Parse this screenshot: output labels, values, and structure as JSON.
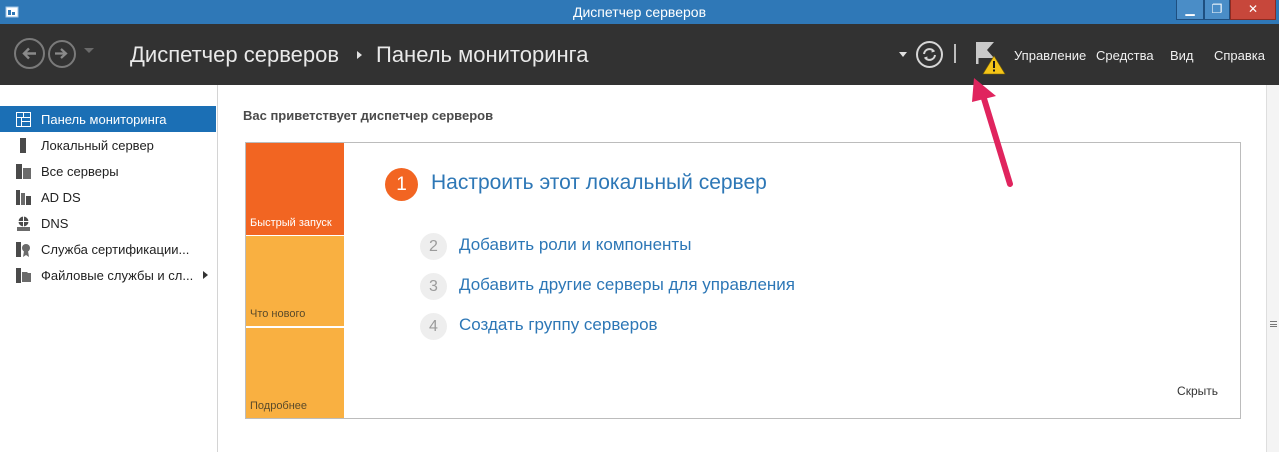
{
  "window": {
    "title": "Диспетчер серверов",
    "controls": {
      "minimize": "▁",
      "maximize": "❐",
      "close": "✕"
    }
  },
  "header": {
    "breadcrumb_root": "Диспетчер серверов",
    "breadcrumb_page": "Панель мониторинга",
    "menu": {
      "manage": "Управление",
      "tools": "Средства",
      "view": "Вид",
      "help": "Справка"
    }
  },
  "sidebar": {
    "items": [
      {
        "label": "Панель мониторинга",
        "icon": "dashboard-icon",
        "active": true
      },
      {
        "label": "Локальный сервер",
        "icon": "local-server-icon"
      },
      {
        "label": "Все серверы",
        "icon": "all-servers-icon"
      },
      {
        "label": "AD DS",
        "icon": "ad-ds-icon"
      },
      {
        "label": "DNS",
        "icon": "dns-icon"
      },
      {
        "label": "Служба сертификации...",
        "icon": "certificate-service-icon"
      },
      {
        "label": "Файловые службы и сл...",
        "icon": "file-services-icon",
        "expandable": true
      }
    ]
  },
  "main": {
    "welcome": "Вас приветствует диспетчер серверов",
    "tiles": {
      "quick_start": "Быстрый запуск",
      "whats_new": "Что нового",
      "learn_more": "Подробнее"
    },
    "steps": [
      {
        "num": "1",
        "label": "Настроить этот локальный сервер"
      },
      {
        "num": "2",
        "label": "Добавить роли и компоненты"
      },
      {
        "num": "3",
        "label": "Добавить другие серверы для управления"
      },
      {
        "num": "4",
        "label": "Создать группу серверов"
      }
    ],
    "hide": "Скрыть"
  },
  "colors": {
    "titlebar": "#2f78b7",
    "header": "#323232",
    "active_item": "#1b6fb5",
    "accent_orange": "#f26522",
    "tile_yellow": "#f9b041",
    "link_blue": "#2d77b6",
    "annotation_arrow": "#e0245e"
  }
}
